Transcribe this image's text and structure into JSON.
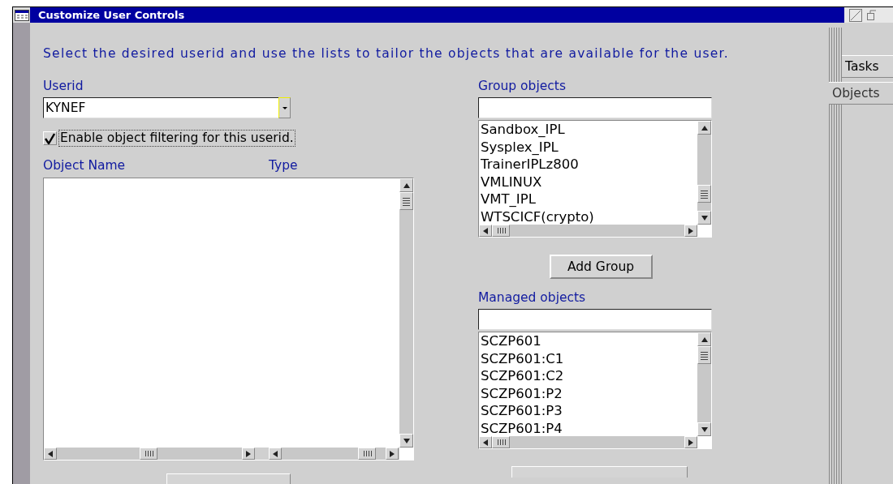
{
  "window": {
    "title": "Customize User Controls"
  },
  "instructions": "Select the desired userid and use the lists to tailor the objects that are available for the user.",
  "userid": {
    "label": "Userid",
    "value": "KYNEF"
  },
  "filter_checkbox": {
    "label": "Enable object filtering for this userid.",
    "checked": true
  },
  "object_table": {
    "columns": [
      "Object Name",
      "Type"
    ]
  },
  "group_objects": {
    "label": "Group objects",
    "items": [
      "Sandbox_IPL",
      "Sysplex_IPL",
      "TrainerIPLz800",
      "VMLINUX",
      "VMT_IPL",
      "WTSCICF(crypto)"
    ]
  },
  "add_group_button": {
    "label": "Add Group"
  },
  "managed_objects": {
    "label": "Managed objects",
    "items": [
      "SCZP601",
      "SCZP601:C1",
      "SCZP601:C2",
      "SCZP601:P2",
      "SCZP601:P3",
      "SCZP601:P4"
    ]
  },
  "tabs": [
    {
      "label": "Tasks",
      "selected": false
    },
    {
      "label": "Objects",
      "selected": true
    }
  ]
}
